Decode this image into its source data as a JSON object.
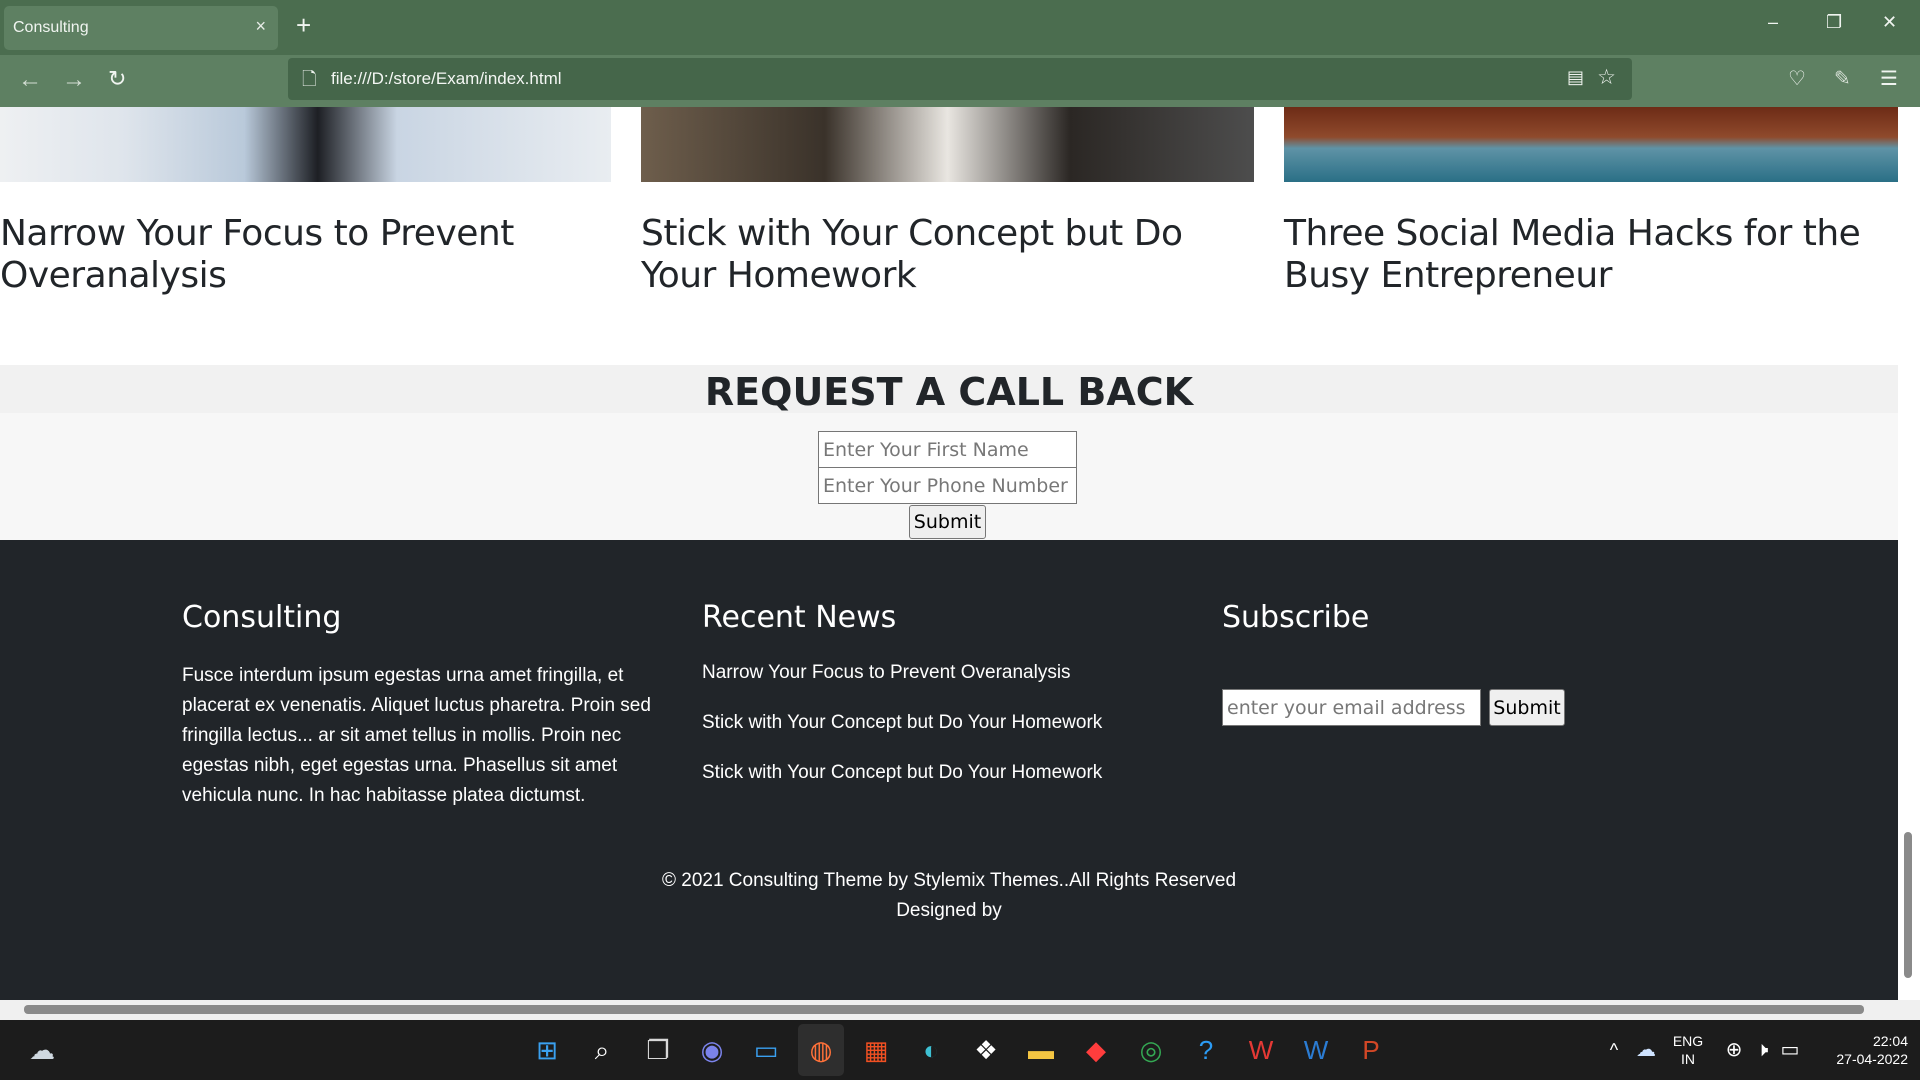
{
  "browser": {
    "tab_title": "Consulting",
    "tab_close": "×",
    "new_tab": "+",
    "url": "file:///D:/store/Exam/index.html",
    "window_minimize": "–",
    "window_restore": "❐",
    "window_close": "✕"
  },
  "cards": [
    {
      "title": "Narrow Your Focus to Prevent Overanalysis"
    },
    {
      "title": "Stick with Your Concept but Do Your Homework"
    },
    {
      "title": "Three Social Media Hacks for the Busy Entrepreneur"
    }
  ],
  "callback": {
    "title": "REQUEST A CALL BACK",
    "first_name_placeholder": "Enter Your First Name",
    "phone_placeholder": "Enter Your Phone Number",
    "submit_label": "Submit"
  },
  "footer": {
    "about": {
      "heading": "Consulting",
      "text": "Fusce interdum ipsum egestas urna amet fringilla, et placerat ex venenatis. Aliquet luctus pharetra. Proin sed fringilla lectus... ar sit amet tellus in mollis. Proin nec egestas nibh, eget egestas urna. Phasellus sit amet vehicula nunc. In hac habitasse platea dictumst."
    },
    "news": {
      "heading": "Recent News",
      "links": [
        "Narrow Your Focus to Prevent Overanalysis",
        "Stick with Your Concept but Do Your Homework",
        "Stick with Your Concept but Do Your Homework"
      ]
    },
    "subscribe": {
      "heading": "Subscribe",
      "email_placeholder": "enter your email address",
      "submit_label": "Submit"
    },
    "copyright": "© 2021 Consulting Theme by Stylemix Themes..All Rights Reserved",
    "designed_by": "Designed by"
  },
  "taskbar": {
    "language": "ENG",
    "region": "IN",
    "time": "22:04",
    "date": "27-04-2022"
  }
}
